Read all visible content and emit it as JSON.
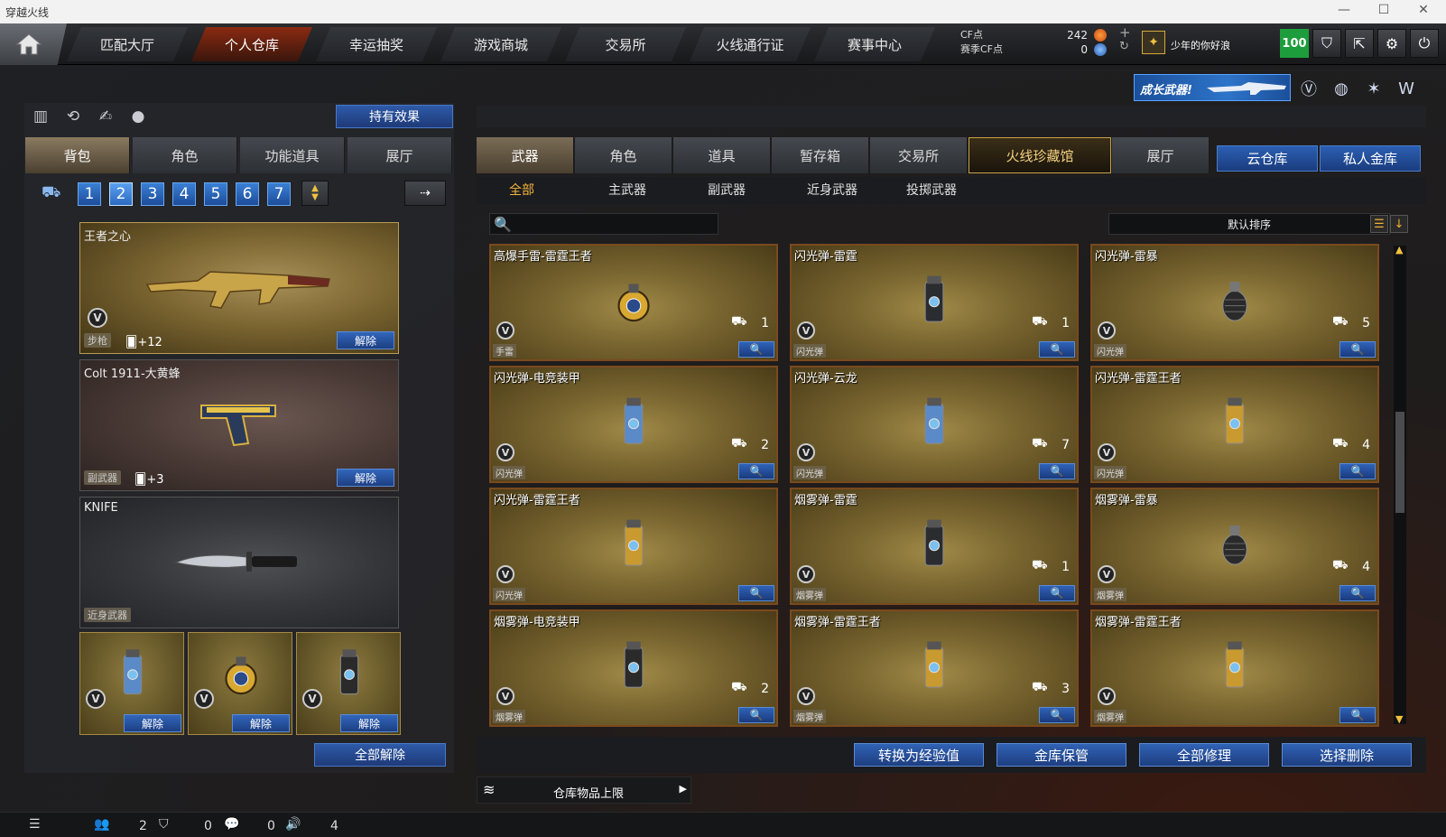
{
  "window": {
    "title": "穿越火线"
  },
  "nav": {
    "tabs": [
      "匹配大厅",
      "个人仓库",
      "幸运抽奖",
      "游戏商城",
      "交易所",
      "火线通行证",
      "赛事中心"
    ],
    "active_index": 1,
    "cf_label": "CF点",
    "season_cf_label": "赛季CF点",
    "cf_value": "242",
    "season_cf_value": "0",
    "username": "少年的你好浪",
    "level": "100"
  },
  "promo": {
    "text": "成长武器!"
  },
  "left": {
    "effect_button": "持有效果",
    "tabs": [
      "背包",
      "角色",
      "功能道具",
      "展厅"
    ],
    "slots": [
      "1",
      "2",
      "3",
      "4",
      "5",
      "6",
      "7"
    ],
    "active_slot": 1,
    "equipped": [
      {
        "name": "王者之心",
        "category": "步枪",
        "bonus": "+12",
        "action": "解除"
      },
      {
        "name": "Colt 1911-大黄蜂",
        "category": "副武器",
        "bonus": "+3",
        "action": "解除"
      },
      {
        "name": "KNIFE",
        "category": "近身武器"
      }
    ],
    "throwables": [
      {
        "action": "解除"
      },
      {
        "action": "解除"
      },
      {
        "action": "解除"
      }
    ],
    "unequip_all": "全部解除"
  },
  "right": {
    "tabs": [
      "武器",
      "角色",
      "道具",
      "暂存箱",
      "交易所",
      "火线珍藏馆",
      "展厅"
    ],
    "active_tab": 0,
    "cloud_buttons": [
      "云仓库",
      "私人金库"
    ],
    "subtabs": [
      "全部",
      "主武器",
      "副武器",
      "近身武器",
      "投掷武器"
    ],
    "active_subtab": 0,
    "sort_label": "默认排序",
    "items": [
      {
        "name": "高爆手雷-雷霆王者",
        "category": "手雷",
        "count": "1"
      },
      {
        "name": "闪光弹-雷霆",
        "category": "闪光弹",
        "count": "1"
      },
      {
        "name": "闪光弹-雷暴",
        "category": "闪光弹",
        "count": "5"
      },
      {
        "name": "闪光弹-电竞装甲",
        "category": "闪光弹",
        "count": "2"
      },
      {
        "name": "闪光弹-云龙",
        "category": "闪光弹",
        "count": "7"
      },
      {
        "name": "闪光弹-雷霆王者",
        "category": "闪光弹",
        "count": "4"
      },
      {
        "name": "闪光弹-雷霆王者",
        "category": "闪光弹",
        "count": ""
      },
      {
        "name": "烟雾弹-雷霆",
        "category": "烟雾弹",
        "count": "1"
      },
      {
        "name": "烟雾弹-雷暴",
        "category": "烟雾弹",
        "count": "4"
      },
      {
        "name": "烟雾弹-电竞装甲",
        "category": "烟雾弹",
        "count": "2"
      },
      {
        "name": "烟雾弹-雷霆王者",
        "category": "烟雾弹",
        "count": "3"
      },
      {
        "name": "烟雾弹-雷霆王者",
        "category": "烟雾弹",
        "count": ""
      }
    ],
    "bottom_buttons": [
      "转换为经验值",
      "金库保管",
      "全部修理",
      "选择删除"
    ],
    "capacity_label": "仓库物品上限"
  },
  "status": {
    "friends": "2",
    "guild": "0",
    "chat": "0",
    "volume": "4"
  }
}
